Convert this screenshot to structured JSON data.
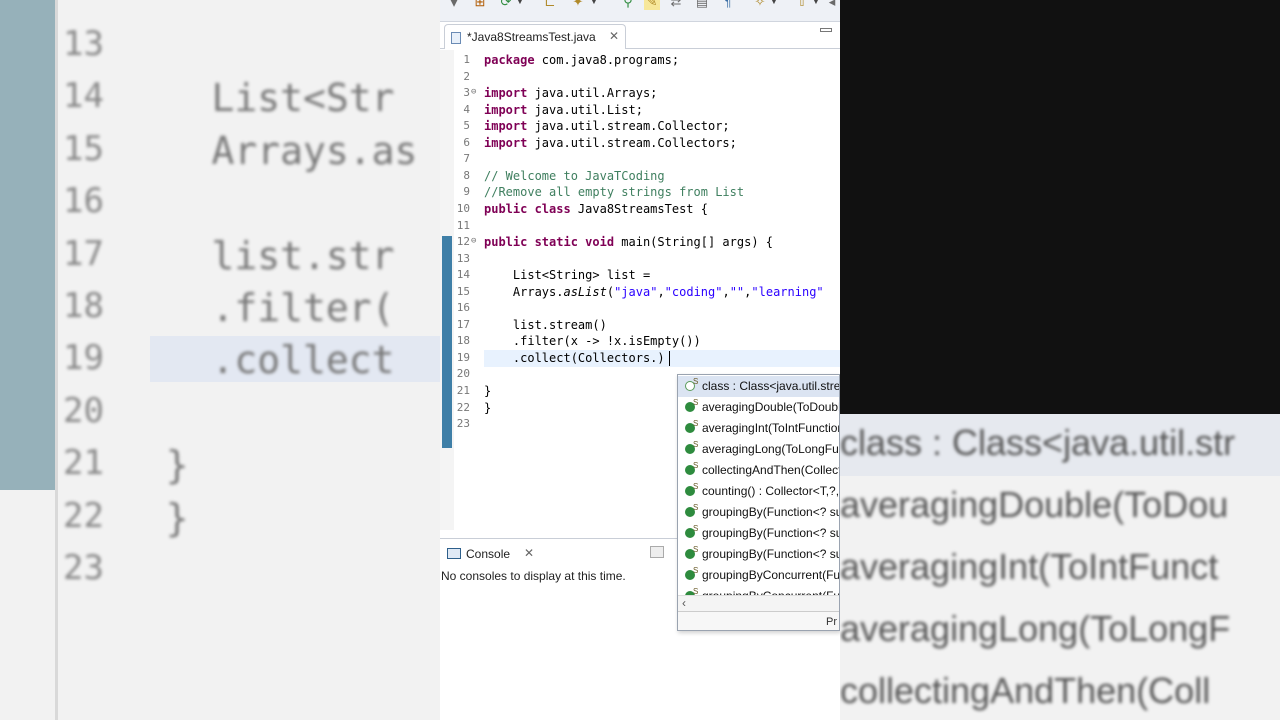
{
  "editor": {
    "tab_title": "*Java8StreamsTest.java",
    "lines": [
      {
        "n": "1",
        "html": "<span class='kw'>package</span> com.java8.programs;"
      },
      {
        "n": "2",
        "html": ""
      },
      {
        "n": "3",
        "html": "<span class='kw'>import</span> java.util.Arrays;",
        "fold": "⊖"
      },
      {
        "n": "4",
        "html": "<span class='kw'>import</span> java.util.List;"
      },
      {
        "n": "5",
        "html": "<span class='kw'>import</span> java.util.stream.Collector;"
      },
      {
        "n": "6",
        "html": "<span class='kw'>import</span> java.util.stream.Collectors;"
      },
      {
        "n": "7",
        "html": ""
      },
      {
        "n": "8",
        "html": "<span class='cm'>// Welcome to JavaTCoding</span>"
      },
      {
        "n": "9",
        "html": "<span class='cm'>//Remove all empty strings from List</span>"
      },
      {
        "n": "10",
        "html": "<span class='kw'>public class</span> Java8StreamsTest {"
      },
      {
        "n": "11",
        "html": ""
      },
      {
        "n": "12",
        "html": "<span class='kw'>public static void</span> main(String[] args) {",
        "fold": "⊖"
      },
      {
        "n": "13",
        "html": ""
      },
      {
        "n": "14",
        "html": "    List&lt;String&gt; list ="
      },
      {
        "n": "15",
        "html": "    Arrays.<span class='it'>asList</span>(<span class='st'>\"java\"</span>,<span class='st'>\"coding\"</span>,<span class='st'>\"\"</span>,<span class='st'>\"learning\"</span>"
      },
      {
        "n": "16",
        "html": ""
      },
      {
        "n": "17",
        "html": "    list.stream()"
      },
      {
        "n": "18",
        "html": "    .filter(x -&gt; !x.isEmpty())"
      },
      {
        "n": "19",
        "html": "    .collect(Collectors.)"
      },
      {
        "n": "20",
        "html": ""
      },
      {
        "n": "21",
        "html": "}"
      },
      {
        "n": "22",
        "html": "}"
      },
      {
        "n": "23",
        "html": ""
      }
    ]
  },
  "assist": {
    "items": [
      {
        "label": "class : Class<java.util.stream.Collectors>",
        "hollow": true,
        "selected": true
      },
      {
        "label": "averagingDouble(ToDoubleFunction<? super T> mapper)"
      },
      {
        "label": "averagingInt(ToIntFunction<? super T> mapper)"
      },
      {
        "label": "averagingLong(ToLongFunction<? super T> mapper)"
      },
      {
        "label": "collectingAndThen(Collector<T,A,R> downstream, Function<R,RR> finisher)"
      },
      {
        "label": "counting() : Collector<T,?,Long>"
      },
      {
        "label": "groupingBy(Function<? super T,? extends K> classifier)"
      },
      {
        "label": "groupingBy(Function<? super T,? extends K> classifier, Collector)"
      },
      {
        "label": "groupingBy(Function<? super T,? extends K> classifier, Supplier)"
      },
      {
        "label": "groupingByConcurrent(Function<? super T,? extends K> classifier)"
      },
      {
        "label": "groupingByConcurrent(Function<? super T,? extends K> classifier, Collector)"
      }
    ],
    "footer": "Pr"
  },
  "console": {
    "tab_label": "Console",
    "message": "No consoles to display at this time."
  },
  "backdrop": {
    "left_lines": [
      {
        "n": "13",
        "text": ""
      },
      {
        "n": "14",
        "text": "    List<Str"
      },
      {
        "n": "15",
        "text": "    Arrays.as"
      },
      {
        "n": "16",
        "text": ""
      },
      {
        "n": "17",
        "text": "    list.str"
      },
      {
        "n": "18",
        "text": "    .filter("
      },
      {
        "n": "19",
        "text": "    .collect"
      },
      {
        "n": "20",
        "text": ""
      },
      {
        "n": "21",
        "text": "  }"
      },
      {
        "n": "22",
        "text": "  }"
      },
      {
        "n": "23",
        "text": ""
      }
    ],
    "right_items": [
      "class : Class<java.util.str",
      "averagingDouble(ToDou",
      "averagingInt(ToIntFunct",
      "averagingLong(ToLongF",
      "collectingAndThen(Coll"
    ]
  }
}
